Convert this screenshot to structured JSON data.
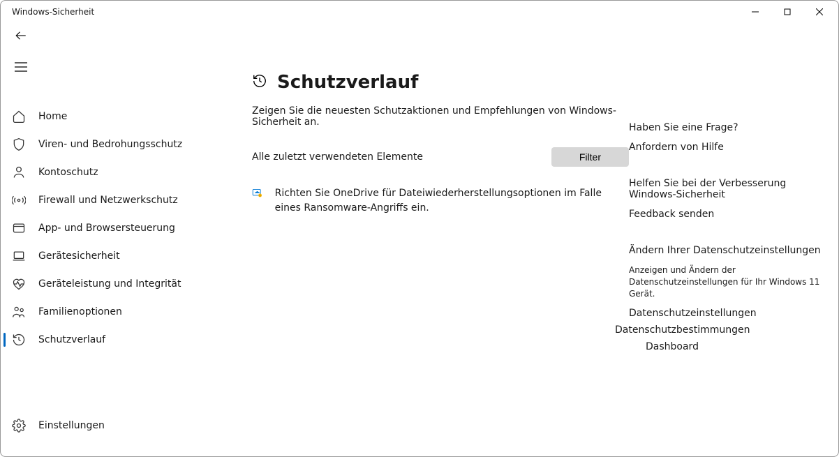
{
  "window": {
    "title": "Windows-Sicherheit"
  },
  "sidebar": {
    "items": [
      {
        "label": "Home"
      },
      {
        "label": "Viren- und Bedrohungsschutz"
      },
      {
        "label": "Kontoschutz"
      },
      {
        "label": "Firewall und Netzwerkschutz"
      },
      {
        "label": "App- und Browsersteuerung"
      },
      {
        "label": "Gerätesicherheit"
      },
      {
        "label": "Geräteleistung und Integrität"
      },
      {
        "label": "Familienoptionen"
      },
      {
        "label": "Schutzverlauf"
      }
    ],
    "settings": {
      "label": "Einstellungen"
    }
  },
  "main": {
    "title": "Schutzverlauf",
    "subtitle": "Zeigen Sie die neuesten Schutzaktionen und Empfehlungen von Windows-Sicherheit an.",
    "filter_label": "Alle zuletzt verwendeten Elemente",
    "filter_button": "Filter",
    "recommendation": "Richten Sie OneDrive für Dateiwiederherstellungsoptionen im Falle eines Ransomware-Angriffs ein."
  },
  "aside": {
    "help": {
      "title": "Haben Sie eine Frage?",
      "link": "Anfordern von Hilfe"
    },
    "improve": {
      "title": "Helfen Sie bei der Verbesserung Windows-Sicherheit",
      "link": "Feedback senden"
    },
    "privacy": {
      "title": "Ändern Ihrer Datenschutzeinstellungen",
      "desc": "Anzeigen und Ändern der Datenschutzeinstellungen für Ihr Windows 11 Gerät.",
      "links": [
        "Datenschutzeinstellungen",
        "Datenschutzbestimmungen",
        "Dashboard"
      ]
    }
  }
}
